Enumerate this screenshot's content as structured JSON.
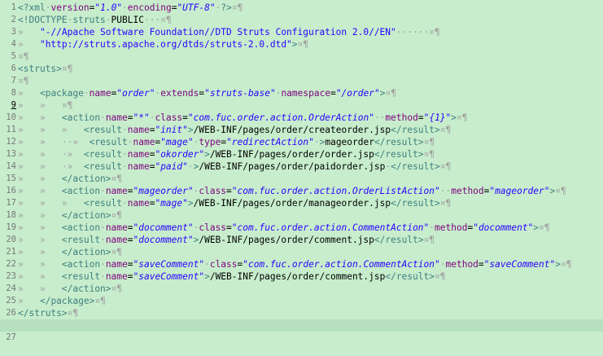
{
  "editor": {
    "lines": [
      {
        "n": "1",
        "segs": [
          [
            "pi",
            "<?"
          ],
          [
            "el",
            "xml"
          ],
          [
            "ws",
            "·"
          ],
          [
            "attr",
            "version"
          ],
          [
            "txt",
            "="
          ],
          [
            "val",
            "\"1.0\""
          ],
          [
            "ws",
            "·"
          ],
          [
            "attr",
            "encoding"
          ],
          [
            "txt",
            "="
          ],
          [
            "val",
            "\"UTF-8\""
          ],
          [
            "ws",
            "·"
          ],
          [
            "pi",
            "?>"
          ],
          [
            "ws",
            "¤¶"
          ]
        ]
      },
      {
        "n": "2",
        "segs": [
          [
            "decl",
            "<!DOCTYPE"
          ],
          [
            "ws",
            "·"
          ],
          [
            "el",
            "struts"
          ],
          [
            "ws",
            "·"
          ],
          [
            "txt",
            "PUBLIC"
          ],
          [
            "ws",
            "···¤¶"
          ]
        ]
      },
      {
        "n": "3",
        "segs": [
          [
            "ws",
            "»   "
          ],
          [
            "str",
            "\"-//Apache Software Foundation//DTD Struts Configuration 2.0//EN\""
          ],
          [
            "ws",
            "······¤¶"
          ]
        ]
      },
      {
        "n": "4",
        "segs": [
          [
            "ws",
            "»   "
          ],
          [
            "str",
            "\"http://struts.apache.org/dtds/struts-2.0.dtd\""
          ],
          [
            "decl",
            ">"
          ],
          [
            "ws",
            "¤¶"
          ]
        ]
      },
      {
        "n": "5",
        "segs": [
          [
            "ws",
            "¤¶"
          ]
        ]
      },
      {
        "n": "6",
        "segs": [
          [
            "tag",
            "<"
          ],
          [
            "el",
            "struts"
          ],
          [
            "tag",
            ">"
          ],
          [
            "ws",
            "¤¶"
          ]
        ]
      },
      {
        "n": "7",
        "segs": [
          [
            "ws",
            "¤¶"
          ]
        ]
      },
      {
        "n": "8",
        "segs": [
          [
            "ws",
            "»   "
          ],
          [
            "tag",
            "<"
          ],
          [
            "el",
            "package"
          ],
          [
            "ws",
            "·"
          ],
          [
            "attr",
            "name"
          ],
          [
            "txt",
            "="
          ],
          [
            "val",
            "\"order\""
          ],
          [
            "ws",
            "·"
          ],
          [
            "attr",
            "extends"
          ],
          [
            "txt",
            "="
          ],
          [
            "val",
            "\"struts-base\""
          ],
          [
            "ws",
            "·"
          ],
          [
            "attr",
            "namespace"
          ],
          [
            "txt",
            "="
          ],
          [
            "val",
            "\"/order\""
          ],
          [
            "tag",
            ">"
          ],
          [
            "ws",
            "¤¶"
          ]
        ]
      },
      {
        "n": "9",
        "segs": [
          [
            "ws",
            "»   »   ¤¶"
          ]
        ]
      },
      {
        "n": "10",
        "segs": [
          [
            "ws",
            "»   »   "
          ],
          [
            "tag",
            "<"
          ],
          [
            "el",
            "action"
          ],
          [
            "ws",
            "·"
          ],
          [
            "attr",
            "name"
          ],
          [
            "txt",
            "="
          ],
          [
            "val",
            "\"*\""
          ],
          [
            "ws",
            "·"
          ],
          [
            "attr",
            "class"
          ],
          [
            "txt",
            "="
          ],
          [
            "val",
            "\"com.fuc.order.action.OrderAction\""
          ],
          [
            "ws",
            "··"
          ],
          [
            "attr",
            "method"
          ],
          [
            "txt",
            "="
          ],
          [
            "val",
            "\"{1}\""
          ],
          [
            "tag",
            ">"
          ],
          [
            "ws",
            "¤¶"
          ]
        ]
      },
      {
        "n": "11",
        "segs": [
          [
            "ws",
            "»   »   »   "
          ],
          [
            "tag",
            "<"
          ],
          [
            "el",
            "result"
          ],
          [
            "ws",
            "·"
          ],
          [
            "attr",
            "name"
          ],
          [
            "txt",
            "="
          ],
          [
            "val",
            "\"init\""
          ],
          [
            "tag",
            ">"
          ],
          [
            "txt",
            "/WEB-INF/pages/order/createorder.jsp"
          ],
          [
            "tag",
            "</"
          ],
          [
            "el",
            "result"
          ],
          [
            "tag",
            ">"
          ],
          [
            "ws",
            "¤¶"
          ]
        ]
      },
      {
        "n": "12",
        "segs": [
          [
            "ws",
            "»   »   ··»  "
          ],
          [
            "tag",
            "<"
          ],
          [
            "el",
            "result"
          ],
          [
            "ws",
            "·"
          ],
          [
            "attr",
            "name"
          ],
          [
            "txt",
            "="
          ],
          [
            "val",
            "\"mage\""
          ],
          [
            "ws",
            "·"
          ],
          [
            "attr",
            "type"
          ],
          [
            "txt",
            "="
          ],
          [
            "val",
            "\"redirectAction\""
          ],
          [
            "ws",
            "·"
          ],
          [
            "tag",
            ">"
          ],
          [
            "txt",
            "mageorder"
          ],
          [
            "tag",
            "</"
          ],
          [
            "el",
            "result"
          ],
          [
            "tag",
            ">"
          ],
          [
            "ws",
            "¤¶"
          ]
        ]
      },
      {
        "n": "13",
        "segs": [
          [
            "ws",
            "»   »   ·»  "
          ],
          [
            "tag",
            "<"
          ],
          [
            "el",
            "result"
          ],
          [
            "ws",
            "·"
          ],
          [
            "attr",
            "name"
          ],
          [
            "txt",
            "="
          ],
          [
            "val",
            "\"okorder\""
          ],
          [
            "tag",
            ">"
          ],
          [
            "txt",
            "/WEB-INF/pages/order/order.jsp"
          ],
          [
            "tag",
            "</"
          ],
          [
            "el",
            "result"
          ],
          [
            "tag",
            ">"
          ],
          [
            "ws",
            "¤¶"
          ]
        ]
      },
      {
        "n": "14",
        "segs": [
          [
            "ws",
            "»   »   ·»  "
          ],
          [
            "tag",
            "<"
          ],
          [
            "el",
            "result"
          ],
          [
            "ws",
            "·"
          ],
          [
            "attr",
            "name"
          ],
          [
            "txt",
            "="
          ],
          [
            "val",
            "\"paid\""
          ],
          [
            "ws",
            "·"
          ],
          [
            "tag",
            ">"
          ],
          [
            "txt",
            "/WEB-INF/pages/order/paidorder.jsp"
          ],
          [
            "ws",
            "·"
          ],
          [
            "tag",
            "</"
          ],
          [
            "el",
            "result"
          ],
          [
            "tag",
            ">"
          ],
          [
            "ws",
            "¤¶"
          ]
        ]
      },
      {
        "n": "15",
        "segs": [
          [
            "ws",
            "»   »   "
          ],
          [
            "tag",
            "</"
          ],
          [
            "el",
            "action"
          ],
          [
            "tag",
            ">"
          ],
          [
            "ws",
            "¤¶"
          ]
        ]
      },
      {
        "n": "16",
        "segs": [
          [
            "ws",
            "»   »   "
          ],
          [
            "tag",
            "<"
          ],
          [
            "el",
            "action"
          ],
          [
            "ws",
            "·"
          ],
          [
            "attr",
            "name"
          ],
          [
            "txt",
            "="
          ],
          [
            "val",
            "\"mageorder\""
          ],
          [
            "ws",
            "·"
          ],
          [
            "attr",
            "class"
          ],
          [
            "txt",
            "="
          ],
          [
            "val",
            "\"com.fuc.order.action.OrderListAction\""
          ],
          [
            "ws",
            "··"
          ],
          [
            "attr",
            "method"
          ],
          [
            "txt",
            "="
          ],
          [
            "val",
            "\"mageorder\""
          ],
          [
            "tag",
            ">"
          ],
          [
            "ws",
            "¤¶"
          ]
        ]
      },
      {
        "n": "17",
        "segs": [
          [
            "ws",
            "»   »   »   "
          ],
          [
            "tag",
            "<"
          ],
          [
            "el",
            "result"
          ],
          [
            "ws",
            "·"
          ],
          [
            "attr",
            "name"
          ],
          [
            "txt",
            "="
          ],
          [
            "val",
            "\"mage\""
          ],
          [
            "tag",
            ">"
          ],
          [
            "txt",
            "/WEB-INF/pages/order/manageorder.jsp"
          ],
          [
            "tag",
            "</"
          ],
          [
            "el",
            "result"
          ],
          [
            "tag",
            ">"
          ],
          [
            "ws",
            "¤¶"
          ]
        ]
      },
      {
        "n": "18",
        "segs": [
          [
            "ws",
            "»   »   "
          ],
          [
            "tag",
            "</"
          ],
          [
            "el",
            "action"
          ],
          [
            "tag",
            ">"
          ],
          [
            "ws",
            "¤¶"
          ]
        ]
      },
      {
        "n": "19",
        "segs": [
          [
            "ws",
            "»   »   "
          ],
          [
            "tag",
            "<"
          ],
          [
            "el",
            "action"
          ],
          [
            "ws",
            "·"
          ],
          [
            "attr",
            "name"
          ],
          [
            "txt",
            "="
          ],
          [
            "val",
            "\"docomment\""
          ],
          [
            "ws",
            "·"
          ],
          [
            "attr",
            "class"
          ],
          [
            "txt",
            "="
          ],
          [
            "val",
            "\"com.fuc.order.action.CommentAction\""
          ],
          [
            "ws",
            "·"
          ],
          [
            "attr",
            "method"
          ],
          [
            "txt",
            "="
          ],
          [
            "val",
            "\"docomment\""
          ],
          [
            "tag",
            ">"
          ],
          [
            "ws",
            "¤¶"
          ]
        ]
      },
      {
        "n": "20",
        "segs": [
          [
            "ws",
            "»   »   "
          ],
          [
            "tag",
            "<"
          ],
          [
            "el",
            "result"
          ],
          [
            "ws",
            "·"
          ],
          [
            "attr",
            "name"
          ],
          [
            "txt",
            "="
          ],
          [
            "val",
            "\"docomment\""
          ],
          [
            "tag",
            ">"
          ],
          [
            "txt",
            "/WEB-INF/pages/order/comment.jsp"
          ],
          [
            "tag",
            "</"
          ],
          [
            "el",
            "result"
          ],
          [
            "tag",
            ">"
          ],
          [
            "ws",
            "¤¶"
          ]
        ]
      },
      {
        "n": "21",
        "segs": [
          [
            "ws",
            "»   »   "
          ],
          [
            "tag",
            "</"
          ],
          [
            "el",
            "action"
          ],
          [
            "tag",
            ">"
          ],
          [
            "ws",
            "¤¶"
          ]
        ]
      },
      {
        "n": "22",
        "segs": [
          [
            "ws",
            "»   »   "
          ],
          [
            "tag",
            "<"
          ],
          [
            "el",
            "action"
          ],
          [
            "ws",
            "·"
          ],
          [
            "attr",
            "name"
          ],
          [
            "txt",
            "="
          ],
          [
            "val",
            "\"saveComment\""
          ],
          [
            "ws",
            "·"
          ],
          [
            "attr",
            "class"
          ],
          [
            "txt",
            "="
          ],
          [
            "val",
            "\"com.fuc.order.action.CommentAction\""
          ],
          [
            "ws",
            "·"
          ],
          [
            "attr",
            "method"
          ],
          [
            "txt",
            "="
          ],
          [
            "val",
            "\"saveComment\""
          ],
          [
            "tag",
            ">"
          ],
          [
            "ws",
            "¤¶"
          ]
        ]
      },
      {
        "n": "23",
        "segs": [
          [
            "ws",
            "»   »   "
          ],
          [
            "tag",
            "<"
          ],
          [
            "el",
            "result"
          ],
          [
            "ws",
            "·"
          ],
          [
            "attr",
            "name"
          ],
          [
            "txt",
            "="
          ],
          [
            "val",
            "\"saveComment\""
          ],
          [
            "tag",
            ">"
          ],
          [
            "txt",
            "/WEB-INF/pages/order/comment.jsp"
          ],
          [
            "tag",
            "</"
          ],
          [
            "el",
            "result"
          ],
          [
            "tag",
            ">"
          ],
          [
            "ws",
            "¤¶"
          ]
        ]
      },
      {
        "n": "24",
        "segs": [
          [
            "ws",
            "»   »   "
          ],
          [
            "tag",
            "</"
          ],
          [
            "el",
            "action"
          ],
          [
            "tag",
            ">"
          ],
          [
            "ws",
            "¤¶"
          ]
        ]
      },
      {
        "n": "25",
        "segs": [
          [
            "ws",
            "»   "
          ],
          [
            "tag",
            "</"
          ],
          [
            "el",
            "package"
          ],
          [
            "tag",
            ">"
          ],
          [
            "ws",
            "¤¶"
          ]
        ]
      },
      {
        "n": "26",
        "segs": [
          [
            "tag",
            "</"
          ],
          [
            "el",
            "struts"
          ],
          [
            "tag",
            ">"
          ],
          [
            "ws",
            "¤¶"
          ]
        ]
      }
    ],
    "current_line": "27",
    "colors": {
      "background": "#c7edcc",
      "element": "#3f7f7f",
      "attribute": "#7f007f",
      "value": "#2a00ff",
      "whitespace": "#a0a0a0"
    }
  }
}
